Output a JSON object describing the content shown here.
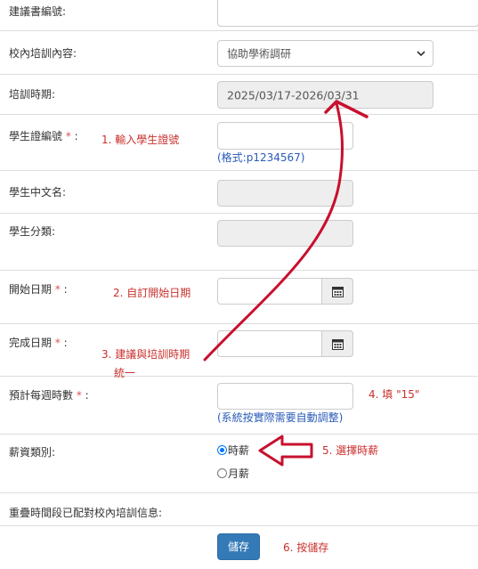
{
  "form": {
    "proposal_no": {
      "label": "建議書編號:",
      "value": ""
    },
    "training_content": {
      "label": "校內培訓內容:",
      "selected": "協助學術調研"
    },
    "training_period": {
      "label": "培訓時期:",
      "value": "2025/03/17-2026/03/31"
    },
    "student_id": {
      "label": "學生證編號",
      "required_mark": "*",
      "colon": ":",
      "value": "",
      "hint": "(格式:p1234567)"
    },
    "student_name": {
      "label": "學生中文名:",
      "value": ""
    },
    "student_category": {
      "label": "學生分類:",
      "value": ""
    },
    "start_date": {
      "label": "開始日期",
      "required_mark": "*",
      "colon": ":",
      "value": ""
    },
    "end_date": {
      "label": "完成日期",
      "required_mark": "*",
      "colon": ":",
      "value": ""
    },
    "weekly_hours": {
      "label": "預計每週時數",
      "required_mark": "*",
      "colon": ":",
      "value": "",
      "hint": "(系統按實際需要自動調整)"
    },
    "pay_type": {
      "label": "薪資類別:",
      "options": [
        "時薪",
        "月薪"
      ],
      "selected": "時薪"
    },
    "overlap": {
      "label": "重疊時間段已配對校內培訓信息:"
    },
    "save_label": "儲存"
  },
  "annotations": {
    "step1": "1. 輸入學生證號",
    "step2": "2. 自訂開始日期",
    "step3_line1": "3. 建議與培訓時期",
    "step3_line2": "統一",
    "step4": "4. 填 \"15\"",
    "step5": "5. 選擇時薪",
    "step6": "6. 按儲存"
  },
  "colors": {
    "annotation_red": "#c9302c",
    "hint_blue": "#2a5bb8",
    "primary_button": "#337ab7",
    "required_red": "#d9534f"
  },
  "icons": [
    "calendar-icon",
    "chevron-down-icon"
  ]
}
